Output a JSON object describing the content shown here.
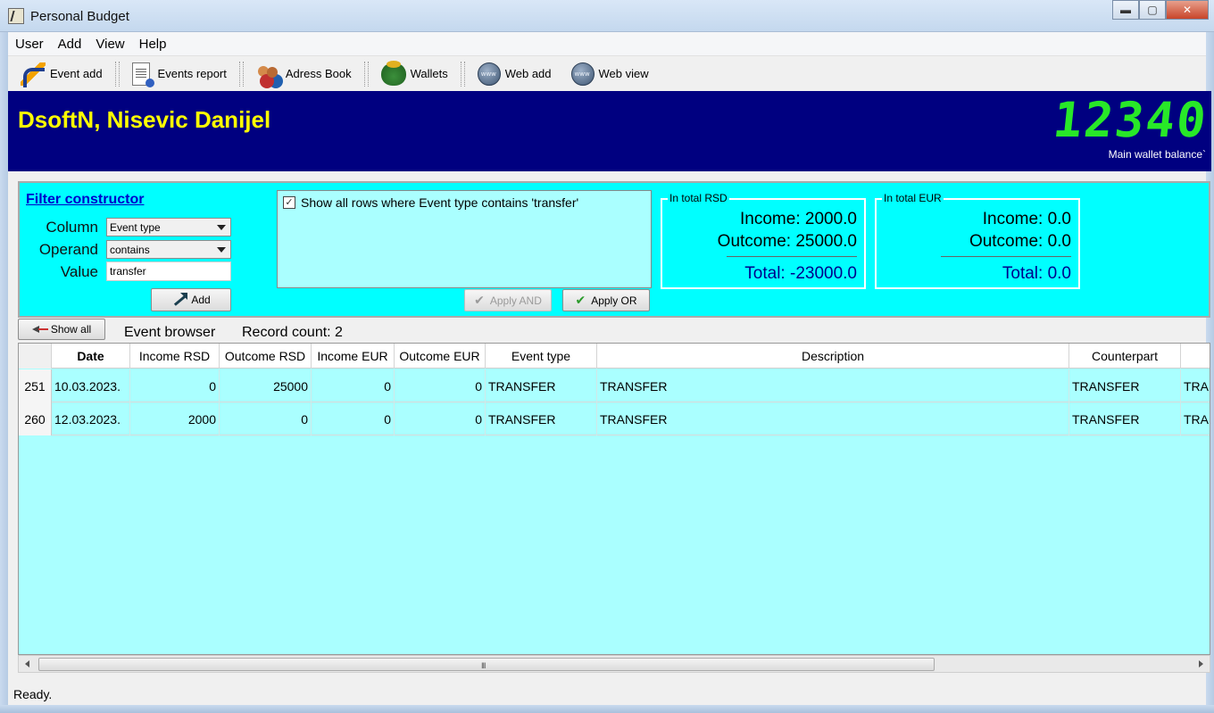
{
  "window": {
    "title": "Personal Budget",
    "minimize": "▬",
    "maximize": "▢",
    "close": "✕"
  },
  "menu": {
    "items": [
      "User",
      "Add",
      "View",
      "Help"
    ]
  },
  "toolbar": {
    "event_add": "Event add",
    "events_report": "Events report",
    "address_book": "Adress Book",
    "wallets": "Wallets",
    "web_add": "Web add",
    "web_view": "Web view"
  },
  "banner": {
    "user_name": "DsoftN, Nisevic Danijel",
    "balance": "12340",
    "balance_label": "Main wallet balance`",
    "colors": {
      "background": "#000080",
      "user": "#ffff00",
      "balance": "#28e828"
    }
  },
  "filter": {
    "title": "Filter constructor",
    "column_label": "Column",
    "column_value": "Event type",
    "operand_label": "Operand",
    "operand_value": "contains",
    "value_label": "Value",
    "value_input": "transfer",
    "add_button": "Add",
    "condition_checked": true,
    "condition_text": "Show all rows where  Event type contains 'transfer'",
    "apply_and": "Apply AND",
    "apply_or": "Apply OR",
    "panel_color": "#00ffff"
  },
  "totals_rsd": {
    "legend": "In total RSD",
    "income": "Income: 2000.0",
    "outcome": "Outcome: 25000.0",
    "total": "Total: -23000.0"
  },
  "totals_eur": {
    "legend": "In total EUR",
    "income": "Income: 0.0",
    "outcome": "Outcome: 0.0",
    "total": "Total: 0.0"
  },
  "browser": {
    "show_all": "Show all",
    "label": "Event browser",
    "record_count": "Record count: 2"
  },
  "grid": {
    "columns": [
      "Date",
      "Income RSD",
      "Outcome RSD",
      "Income EUR",
      "Outcome EUR",
      "Event type",
      "Description",
      "Counterpart",
      ""
    ],
    "rows": [
      {
        "id": "251",
        "date": "10.03.2023.",
        "income_rsd": "0",
        "outcome_rsd": "25000",
        "income_eur": "0",
        "outcome_eur": "0",
        "event_type": "TRANSFER",
        "description": "TRANSFER",
        "counterpart": "TRANSFER",
        "extra": "TRANSFER"
      },
      {
        "id": "260",
        "date": "12.03.2023.",
        "income_rsd": "2000",
        "outcome_rsd": "0",
        "income_eur": "0",
        "outcome_eur": "0",
        "event_type": "TRANSFER",
        "description": "TRANSFER",
        "counterpart": "TRANSFER",
        "extra": "TRANSFER"
      }
    ],
    "row_color": "#aaffff"
  },
  "scrollbar": {
    "grip": "III"
  },
  "status": {
    "text": "Ready."
  }
}
